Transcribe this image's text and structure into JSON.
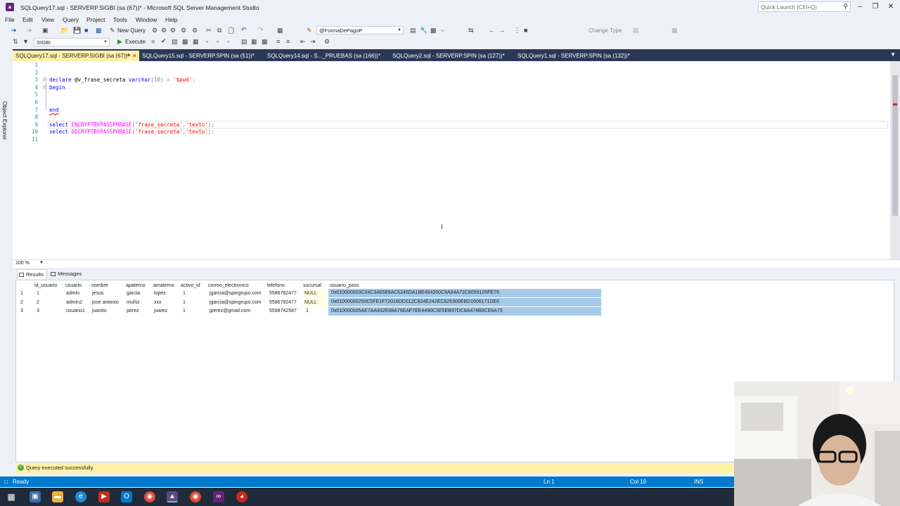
{
  "window": {
    "title": "SQLQuery17.sql - SERVERP.SIGBI (sa (67))* - Microsoft SQL Server Management Studio",
    "quick_launch_placeholder": "Quick Launch (Ctrl+Q)"
  },
  "menu": [
    "File",
    "Edit",
    "View",
    "Query",
    "Project",
    "Tools",
    "Window",
    "Help"
  ],
  "toolbar": {
    "new_query": "New Query",
    "object_combo": "@FormaDePagoP",
    "change_type": "Change Type",
    "database": "SIGBI",
    "execute": "Execute"
  },
  "object_explorer_label": "Object Explorer",
  "tabs": [
    {
      "label": "SQLQuery17.sql - SERVERP.SIGBI (sa (67))*",
      "active": true
    },
    {
      "label": "SQLQuery15.sql - SERVERP.SPIN (sa (51))*",
      "active": false
    },
    {
      "label": "SQLQuery14.sql - S..._PRUEBAS (sa (166))*",
      "active": false
    },
    {
      "label": "SQLQuery2.sql - SERVERP.SPIN (sa (127))*",
      "active": false
    },
    {
      "label": "SQLQuery1.sql - SERVERP.SPIN (sa (132))*",
      "active": false
    }
  ],
  "editor": {
    "line_numbers": [
      "1",
      "2",
      "3",
      "4",
      "5",
      "6",
      "7",
      "8",
      "9",
      "10",
      "11"
    ],
    "line3": {
      "kw1": "declare",
      "var": " @v_frase_secreta ",
      "type": "varchar",
      "rest": "(10) = ",
      "str": "'$pwd'",
      "end": ";"
    },
    "line4": "begin",
    "line7": "end",
    "line9": {
      "kw": "select ",
      "fn": "ENCRYPTBYPASSPHRASE",
      "open": "(",
      "s1": "'frase_secreta'",
      "comma": ",",
      "s2": "'texto'",
      "close": ");"
    },
    "line10": {
      "kw": "select ",
      "fn": "DECRYPTBYPASSPHRASE",
      "open": "(",
      "s1": "'frase_secreta'",
      "comma": ",",
      "s2": "'texto'",
      "close": ");"
    }
  },
  "zoom": "100 %",
  "results_tabs": {
    "results": "Results",
    "messages": "Messages"
  },
  "grid": {
    "columns": [
      "id_usuario",
      "usuario",
      "nombre",
      "apaterno",
      "amaterno",
      "activo_id",
      "correo_electronico",
      "telefono",
      "sucursal",
      "usuario_pass"
    ],
    "rows": [
      {
        "n": "1",
        "cells": [
          "1",
          "admin",
          "jesus",
          "garcia",
          "lopez",
          "1",
          "jgarcia@spingrupo.com",
          "5586782477",
          "NULL",
          "0x010000003C04C3A6589AC6245DA1BE464350C8A84A72C8059105FE76"
        ]
      },
      {
        "n": "2",
        "cells": [
          "2",
          "admin2",
          "jose antonio",
          "muñiz",
          "xxx",
          "1",
          "jgarcia@spingrupo.com",
          "5586782477",
          "NULL",
          "0x01000000250C5FE1F72016DD012C824E242EC626300EBD1606171DE6"
        ]
      },
      {
        "n": "3",
        "cells": [
          "3",
          "usuario1",
          "juanito",
          "perez",
          "juarez",
          "1",
          "jperez@gmail.com",
          "5598742587",
          "1",
          "0x010000005AE7AA932E88A76EAF7EE4490C3E5EB97DC8A474B8CE6A75"
        ]
      }
    ]
  },
  "query_status": "Query executed successfully.",
  "statusbar": {
    "ready": "Ready",
    "ln": "Ln 1",
    "col": "Col 10",
    "ins": "INS"
  },
  "colors": {
    "accent": "#007acc",
    "tab_bg": "#293955",
    "active_tab": "#fff1a8",
    "selection": "#a6cbe9"
  }
}
